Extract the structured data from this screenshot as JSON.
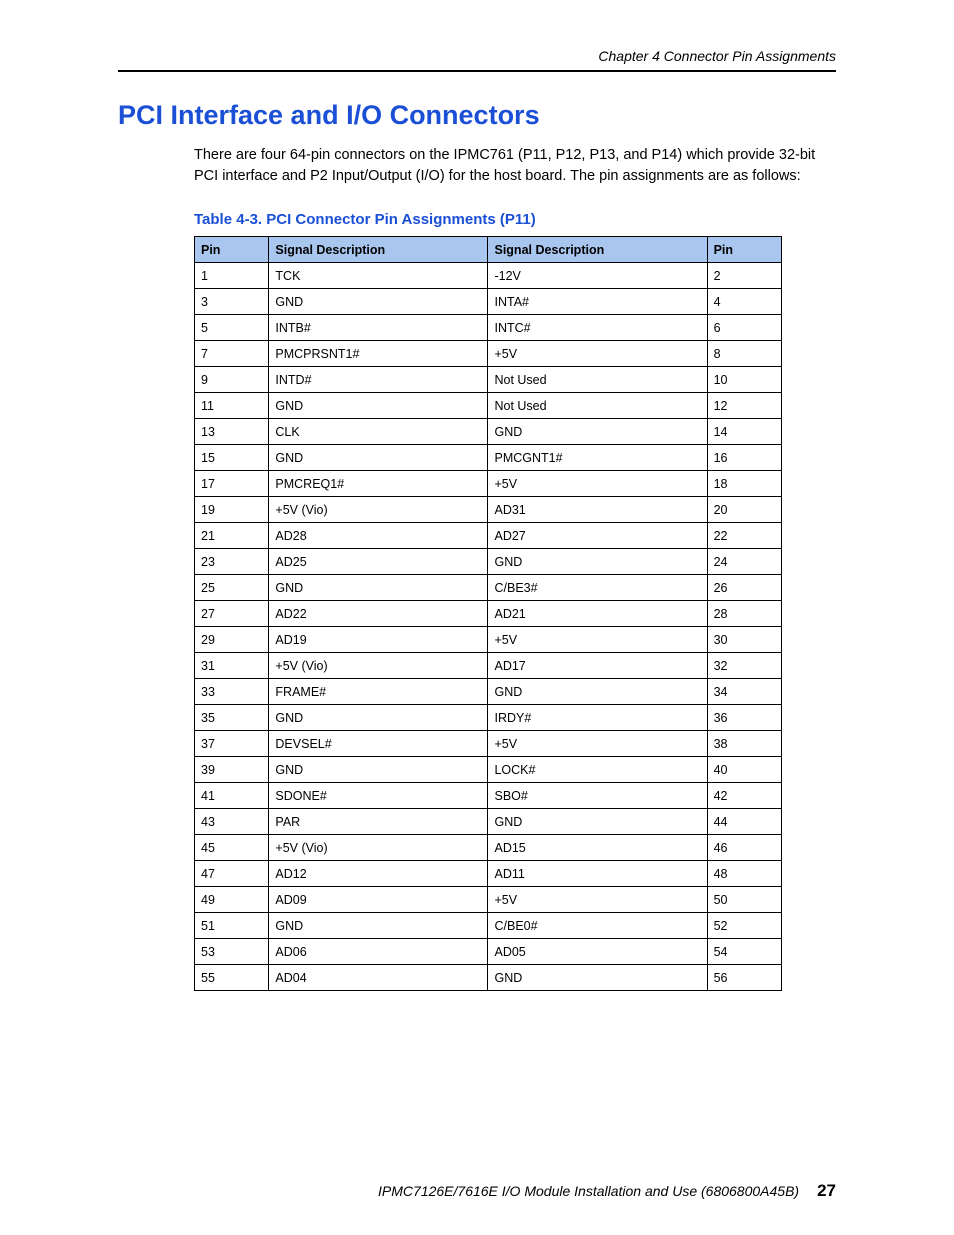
{
  "header": {
    "chapter": "Chapter 4  Connector Pin Assignments"
  },
  "section": {
    "title": "PCI Interface and I/O Connectors",
    "intro": "There are four 64-pin connectors on the IPMC761 (P11, P12, P13, and P14) which provide 32-bit PCI interface and P2 Input/Output (I/O) for the host board. The pin assignments are as follows:"
  },
  "table": {
    "title": "Table 4-3. PCI Connector Pin Assignments (P11)",
    "headers": {
      "pin_a": "Pin",
      "sig_a": "Signal Description",
      "sig_b": "Signal Description",
      "pin_b": "Pin"
    },
    "rows": [
      {
        "pin_a": "1",
        "sig_a": "TCK",
        "sig_b": "-12V",
        "pin_b": "2"
      },
      {
        "pin_a": "3",
        "sig_a": "GND",
        "sig_b": "INTA#",
        "pin_b": "4"
      },
      {
        "pin_a": "5",
        "sig_a": "INTB#",
        "sig_b": "INTC#",
        "pin_b": "6"
      },
      {
        "pin_a": "7",
        "sig_a": "PMCPRSNT1#",
        "sig_b": "+5V",
        "pin_b": "8"
      },
      {
        "pin_a": "9",
        "sig_a": "INTD#",
        "sig_b": "Not Used",
        "pin_b": "10"
      },
      {
        "pin_a": "11",
        "sig_a": "GND",
        "sig_b": "Not Used",
        "pin_b": "12"
      },
      {
        "pin_a": "13",
        "sig_a": "CLK",
        "sig_b": "GND",
        "pin_b": "14"
      },
      {
        "pin_a": "15",
        "sig_a": "GND",
        "sig_b": "PMCGNT1#",
        "pin_b": "16"
      },
      {
        "pin_a": "17",
        "sig_a": "PMCREQ1#",
        "sig_b": "+5V",
        "pin_b": "18"
      },
      {
        "pin_a": "19",
        "sig_a": "+5V (Vio)",
        "sig_b": "AD31",
        "pin_b": "20"
      },
      {
        "pin_a": "21",
        "sig_a": "AD28",
        "sig_b": "AD27",
        "pin_b": "22"
      },
      {
        "pin_a": "23",
        "sig_a": "AD25",
        "sig_b": "GND",
        "pin_b": "24"
      },
      {
        "pin_a": "25",
        "sig_a": "GND",
        "sig_b": "C/BE3#",
        "pin_b": "26"
      },
      {
        "pin_a": "27",
        "sig_a": "AD22",
        "sig_b": "AD21",
        "pin_b": "28"
      },
      {
        "pin_a": "29",
        "sig_a": "AD19",
        "sig_b": "+5V",
        "pin_b": "30"
      },
      {
        "pin_a": "31",
        "sig_a": "+5V (Vio)",
        "sig_b": "AD17",
        "pin_b": "32"
      },
      {
        "pin_a": "33",
        "sig_a": "FRAME#",
        "sig_b": "GND",
        "pin_b": "34"
      },
      {
        "pin_a": "35",
        "sig_a": "GND",
        "sig_b": "IRDY#",
        "pin_b": "36"
      },
      {
        "pin_a": "37",
        "sig_a": "DEVSEL#",
        "sig_b": "+5V",
        "pin_b": "38"
      },
      {
        "pin_a": "39",
        "sig_a": "GND",
        "sig_b": "LOCK#",
        "pin_b": "40"
      },
      {
        "pin_a": "41",
        "sig_a": "SDONE#",
        "sig_b": "SBO#",
        "pin_b": "42"
      },
      {
        "pin_a": "43",
        "sig_a": "PAR",
        "sig_b": "GND",
        "pin_b": "44"
      },
      {
        "pin_a": "45",
        "sig_a": "+5V (Vio)",
        "sig_b": "AD15",
        "pin_b": "46"
      },
      {
        "pin_a": "47",
        "sig_a": "AD12",
        "sig_b": "AD11",
        "pin_b": "48"
      },
      {
        "pin_a": "49",
        "sig_a": "AD09",
        "sig_b": "+5V",
        "pin_b": "50"
      },
      {
        "pin_a": "51",
        "sig_a": "GND",
        "sig_b": "C/BE0#",
        "pin_b": "52"
      },
      {
        "pin_a": "53",
        "sig_a": "AD06",
        "sig_b": "AD05",
        "pin_b": "54"
      },
      {
        "pin_a": "55",
        "sig_a": "AD04",
        "sig_b": "GND",
        "pin_b": "56"
      }
    ]
  },
  "footer": {
    "doc": "IPMC7126E/7616E I/O Module Installation and Use (6806800A45B)",
    "pageno": "27"
  }
}
